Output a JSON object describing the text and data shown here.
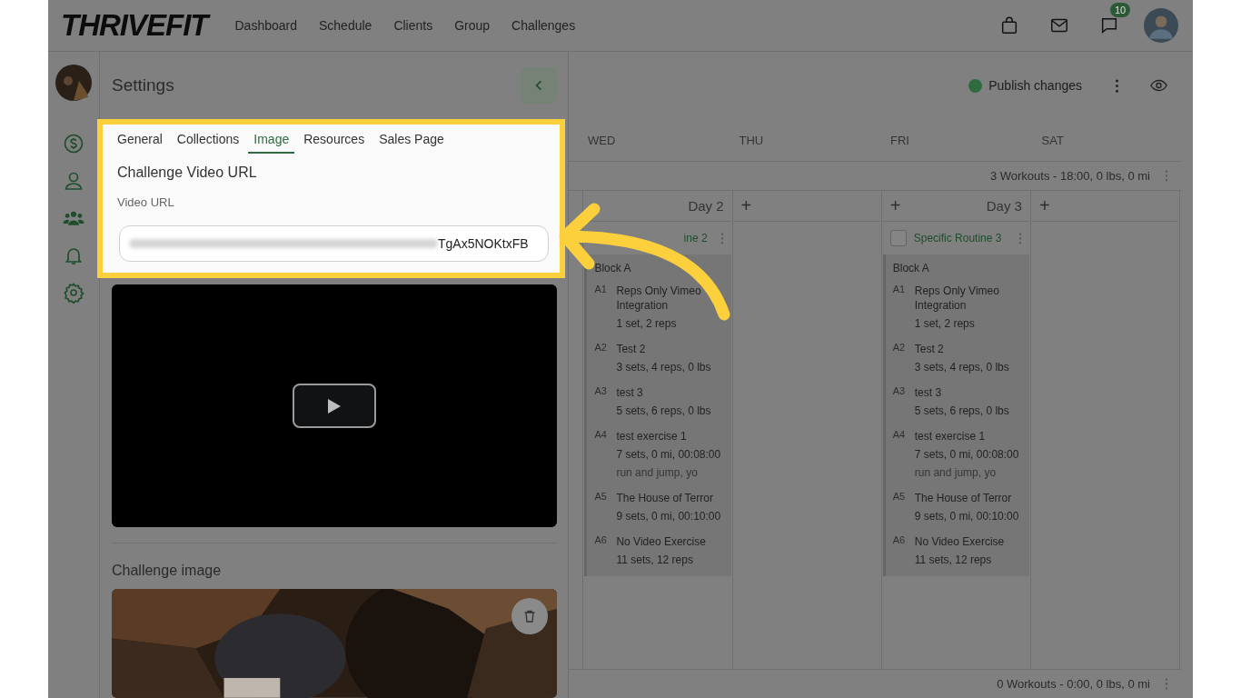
{
  "header": {
    "logo": "THRIVEFIT",
    "nav": [
      "Dashboard",
      "Schedule",
      "Clients",
      "Group",
      "Challenges"
    ],
    "message_count": "10"
  },
  "settings": {
    "title": "Settings",
    "tabs": [
      {
        "label": "General",
        "selected": false
      },
      {
        "label": "Collections",
        "selected": false
      },
      {
        "label": "Image",
        "selected": true
      },
      {
        "label": "Resources",
        "selected": false
      },
      {
        "label": "Sales Page",
        "selected": false
      }
    ],
    "section_title": "Challenge Video URL",
    "field_label": "Video URL",
    "field_value": "TgAx5NOKtxFB",
    "image_title": "Challenge image"
  },
  "calendar": {
    "publish_label": "Publish changes",
    "days": [
      "WED",
      "THU",
      "FRI",
      "SAT"
    ],
    "week_summaries": [
      "3 Workouts - 18:00, 0 lbs, 0 mi",
      "0 Workouts - 0:00, 0 lbs, 0 mi"
    ],
    "columns": [
      {
        "day_label": "Day 2",
        "routine": {
          "title": "ine 2",
          "block": "Block A",
          "exercises": [
            {
              "index": "A1",
              "name": "Reps Only Vimeo Integration",
              "detail": "1 set, 2 reps"
            },
            {
              "index": "A2",
              "name": "Test 2",
              "detail": "3 sets, 4 reps, 0 lbs"
            },
            {
              "index": "A3",
              "name": "test 3",
              "detail": "5 sets, 6 reps, 0 lbs"
            },
            {
              "index": "A4",
              "name": "test exercise 1",
              "detail": "7 sets, 0 mi, 00:08:00",
              "note": "run and jump, yo"
            },
            {
              "index": "A5",
              "name": "The House of Terror",
              "detail": "9 sets, 0 mi, 00:10:00"
            },
            {
              "index": "A6",
              "name": "No Video Exercise",
              "detail": "11 sets, 12 reps"
            }
          ]
        }
      },
      {
        "add_label": "+"
      },
      {
        "add_label": "+",
        "day_label": "Day 3",
        "routine": {
          "title": "Specific Routine 3",
          "checked": false,
          "block": "Block A",
          "exercises": [
            {
              "index": "A1",
              "name": "Reps Only Vimeo Integration",
              "detail": "1 set, 2 reps"
            },
            {
              "index": "A2",
              "name": "Test 2",
              "detail": "3 sets, 4 reps, 0 lbs"
            },
            {
              "index": "A3",
              "name": "test 3",
              "detail": "5 sets, 6 reps, 0 lbs"
            },
            {
              "index": "A4",
              "name": "test exercise 1",
              "detail": "7 sets, 0 mi, 00:08:00",
              "note": "run and jump, yo"
            },
            {
              "index": "A5",
              "name": "The House of Terror",
              "detail": "9 sets, 0 mi, 00:10:00"
            },
            {
              "index": "A6",
              "name": "No Video Exercise",
              "detail": "11 sets, 12 reps"
            }
          ]
        }
      },
      {
        "add_label": "+"
      }
    ]
  }
}
